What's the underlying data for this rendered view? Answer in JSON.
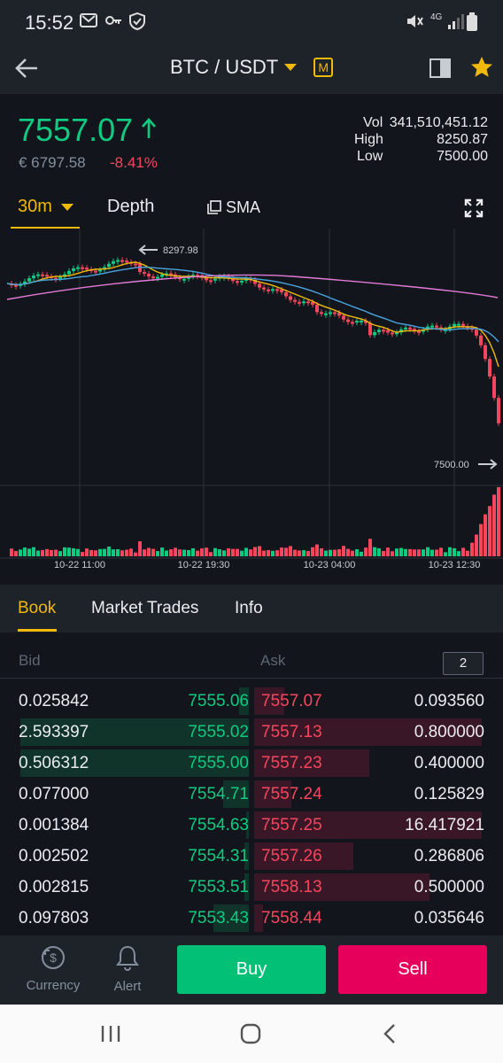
{
  "status_bar": {
    "time": "15:52",
    "network": "4G"
  },
  "header": {
    "title": "BTC / USDT",
    "margin_badge": "M",
    "icons": [
      "back-arrow-icon",
      "chevron-down-icon",
      "layout-icon",
      "star-icon"
    ]
  },
  "ticker": {
    "last_price": "7557.07",
    "fiat_price": "€ 6797.58",
    "change_pct": "-8.41%",
    "vol_label": "Vol",
    "vol_value": "341,510,451.12",
    "high_label": "High",
    "high_value": "8250.87",
    "low_label": "Low",
    "low_value": "7500.00"
  },
  "chart_toolbar": {
    "interval": "30m",
    "depth": "Depth",
    "indicator": "SMA"
  },
  "chart": {
    "high_marker": "8297.98",
    "low_marker": "7500.00",
    "time_labels": [
      "10-22 11:00",
      "10-22 19:30",
      "10-23 04:00",
      "10-23 12:30"
    ]
  },
  "tabs": {
    "book": "Book",
    "trades": "Market Trades",
    "info": "Info"
  },
  "book": {
    "bid_label": "Bid",
    "ask_label": "Ask",
    "precision": "2",
    "rows": [
      {
        "bid_qty": "0.025842",
        "bid_price": "7555.06",
        "ask_price": "7557.07",
        "ask_qty": "0.093560",
        "bid_depth": 0.04,
        "ask_depth": 0.13
      },
      {
        "bid_qty": "2.593397",
        "bid_price": "7555.02",
        "ask_price": "7557.13",
        "ask_qty": "0.800000",
        "bid_depth": 0.97,
        "ask_depth": 0.99
      },
      {
        "bid_qty": "0.506312",
        "bid_price": "7555.00",
        "ask_price": "7557.23",
        "ask_qty": "0.400000",
        "bid_depth": 0.97,
        "ask_depth": 0.5
      },
      {
        "bid_qty": "0.077000",
        "bid_price": "7554.71",
        "ask_price": "7557.24",
        "ask_qty": "0.125829",
        "bid_depth": 0.11,
        "ask_depth": 0.16
      },
      {
        "bid_qty": "0.001384",
        "bid_price": "7554.63",
        "ask_price": "7557.25",
        "ask_qty": "16.417921",
        "bid_depth": 0.01,
        "ask_depth": 0.99
      },
      {
        "bid_qty": "0.002502",
        "bid_price": "7554.31",
        "ask_price": "7557.26",
        "ask_qty": "0.286806",
        "bid_depth": 0.02,
        "ask_depth": 0.43
      },
      {
        "bid_qty": "0.002815",
        "bid_price": "7553.51",
        "ask_price": "7558.13",
        "ask_qty": "0.500000",
        "bid_depth": 0.02,
        "ask_depth": 0.76
      },
      {
        "bid_qty": "0.097803",
        "bid_price": "7553.43",
        "ask_price": "7558.44",
        "ask_qty": "0.035646",
        "bid_depth": 0.15,
        "ask_depth": 0.04
      }
    ]
  },
  "actions": {
    "currency": "Currency",
    "alert": "Alert",
    "buy": "Buy",
    "sell": "Sell"
  },
  "colors": {
    "up": "#0ecb81",
    "down": "#f6465d",
    "accent": "#f0b90b",
    "buy_button": "#02c076",
    "sell_button": "#e6005c"
  }
}
